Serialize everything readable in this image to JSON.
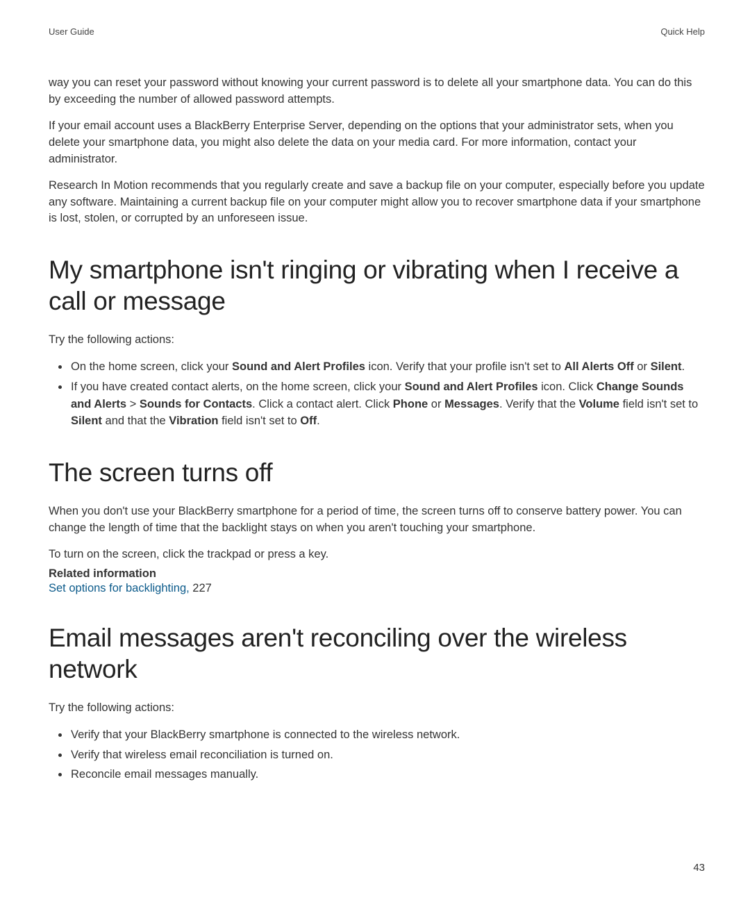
{
  "header": {
    "left": "User Guide",
    "right": "Quick Help"
  },
  "intro": {
    "p1": "way you can reset your password without knowing your current password is to delete all your smartphone data. You can do this by exceeding the number of allowed password attempts.",
    "p2": "If your email account uses a BlackBerry Enterprise Server, depending on the options that your administrator sets, when you delete your smartphone data, you might also delete the data on your media card. For more information, contact your administrator.",
    "p3": "Research In Motion recommends that you regularly create and save a backup file on your computer, especially before you update any software. Maintaining a current backup file on your computer might allow you to recover smartphone data if your smartphone is lost, stolen, or corrupted by an unforeseen issue."
  },
  "section1": {
    "heading": "My smartphone isn't ringing or vibrating when I receive a call or message",
    "lead": "Try the following actions:",
    "bullet1": {
      "t1": "On the home screen, click your ",
      "b1": "Sound and Alert Profiles",
      "t2": " icon. Verify that your profile isn't set to ",
      "b2": "All Alerts Off",
      "t3": " or ",
      "b3": "Silent",
      "t4": "."
    },
    "bullet2": {
      "t1": "If you have created contact alerts, on the home screen, click your ",
      "b1": "Sound and Alert Profiles",
      "t2": " icon. Click ",
      "b2": "Change Sounds and Alerts",
      "t3": " > ",
      "b3": "Sounds for Contacts",
      "t4": ". Click a contact alert. Click ",
      "b4": "Phone",
      "t5": " or ",
      "b5": "Messages",
      "t6": ". Verify that the ",
      "b6": "Volume",
      "t7": " field isn't set to ",
      "b7": "Silent",
      "t8": " and that the ",
      "b8": "Vibration",
      "t9": " field isn't set to ",
      "b9": "Off",
      "t10": "."
    }
  },
  "section2": {
    "heading": "The screen turns off",
    "p1": "When you don't use your BlackBerry smartphone for a period of time, the screen turns off to conserve battery power. You can change the length of time that the backlight stays on when you aren't touching your smartphone.",
    "p2": "To turn on the screen, click the trackpad or press a key.",
    "relatedLabel": "Related information",
    "link": "Set options for backlighting, ",
    "linkPage": "227"
  },
  "section3": {
    "heading": "Email messages aren't reconciling over the wireless network",
    "lead": "Try the following actions:",
    "bullet1": "Verify that your BlackBerry smartphone is connected to the wireless network.",
    "bullet2": "Verify that wireless email reconciliation is turned on.",
    "bullet3": "Reconcile email messages manually."
  },
  "pageNumber": "43"
}
